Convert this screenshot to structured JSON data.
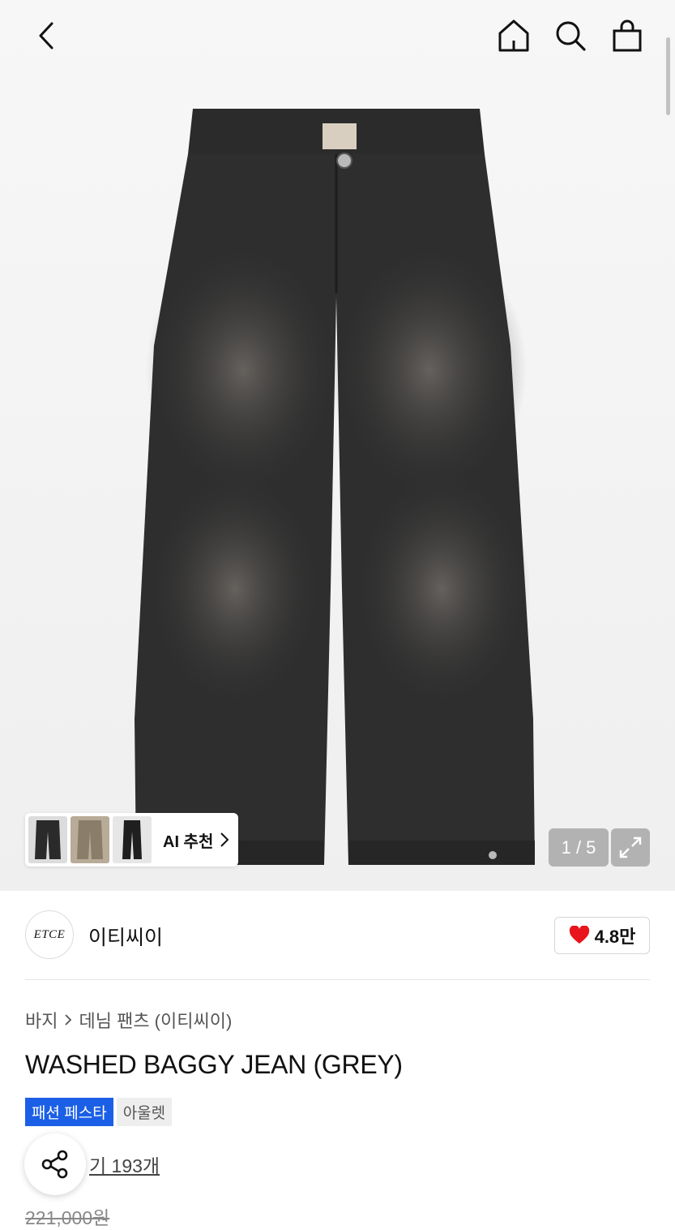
{
  "header": {
    "icons": [
      "back-icon",
      "home-icon",
      "search-icon",
      "shopping-bag-icon"
    ]
  },
  "gallery": {
    "counter": "1 / 5",
    "ai_recommend_label": "AI 추천",
    "thumbnails": [
      "black-jeans",
      "washed-brown-jeans",
      "black-slim-jeans"
    ]
  },
  "brand": {
    "logo_text": "ETCE",
    "name": "이티씨이",
    "like_count": "4.8만"
  },
  "breadcrumb": {
    "category": "바지",
    "subcategory": "데님 팬츠 (이티씨이)"
  },
  "product": {
    "title": "WASHED BAGGY JEAN (GREY)",
    "badges": [
      "패션 페스타",
      "아울렛"
    ],
    "review_text": "기 193개",
    "price": "221,000원"
  },
  "colors": {
    "accent_blue": "#1b5fe6",
    "heart_red": "#e8151c",
    "denim": "#2e2e2e"
  }
}
